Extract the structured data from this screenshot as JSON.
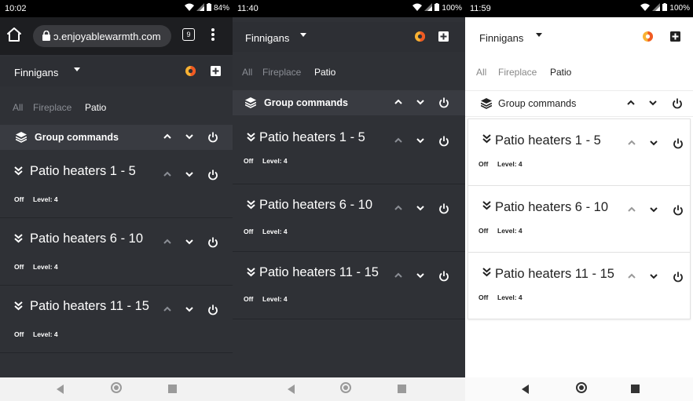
{
  "colors": {
    "dark_bg": "#2f3136",
    "group_bar_dark": "#393b41",
    "brand_orange": "#f05a23",
    "brand_yellow": "#f9b233"
  },
  "phone1": {
    "status": {
      "time": "10:02",
      "battery": "84%"
    },
    "browser": {
      "url": "ɔ.enjoyablewarmth.com",
      "tab_count": "9"
    },
    "toolbar": {
      "title": "Finnigans"
    },
    "filters": [
      "All",
      "Fireplace",
      "Patio"
    ],
    "group": {
      "label": "Group commands"
    },
    "cards": [
      {
        "title": "Patio heaters 1 - 5",
        "state": "Off",
        "level": "Level: 4"
      },
      {
        "title": "Patio heaters 6 - 10",
        "state": "Off",
        "level": "Level: 4"
      },
      {
        "title": "Patio heaters 11 - 15",
        "state": "Off",
        "level": "Level: 4"
      }
    ]
  },
  "phone2": {
    "status": {
      "time": "11:40",
      "battery": "100%"
    },
    "toolbar": {
      "title": "Finnigans"
    },
    "filters": [
      "All",
      "Fireplace",
      "Patio"
    ],
    "group": {
      "label": "Group commands"
    },
    "cards": [
      {
        "title": "Patio heaters 1 - 5",
        "state": "Off",
        "level": "Level: 4"
      },
      {
        "title": "Patio heaters 6 - 10",
        "state": "Off",
        "level": "Level: 4"
      },
      {
        "title": "Patio heaters 11 - 15",
        "state": "Off",
        "level": "Level: 4"
      }
    ]
  },
  "phone3": {
    "status": {
      "time": "11:59",
      "battery": "100%"
    },
    "toolbar": {
      "title": "Finnigans"
    },
    "filters": [
      "All",
      "Fireplace",
      "Patio"
    ],
    "group": {
      "label": "Group commands"
    },
    "cards": [
      {
        "title": "Patio heaters 1 - 5",
        "state": "Off",
        "level": "Level: 4"
      },
      {
        "title": "Patio heaters 6 - 10",
        "state": "Off",
        "level": "Level: 4"
      },
      {
        "title": "Patio heaters 11 - 15",
        "state": "Off",
        "level": "Level: 4"
      }
    ]
  }
}
